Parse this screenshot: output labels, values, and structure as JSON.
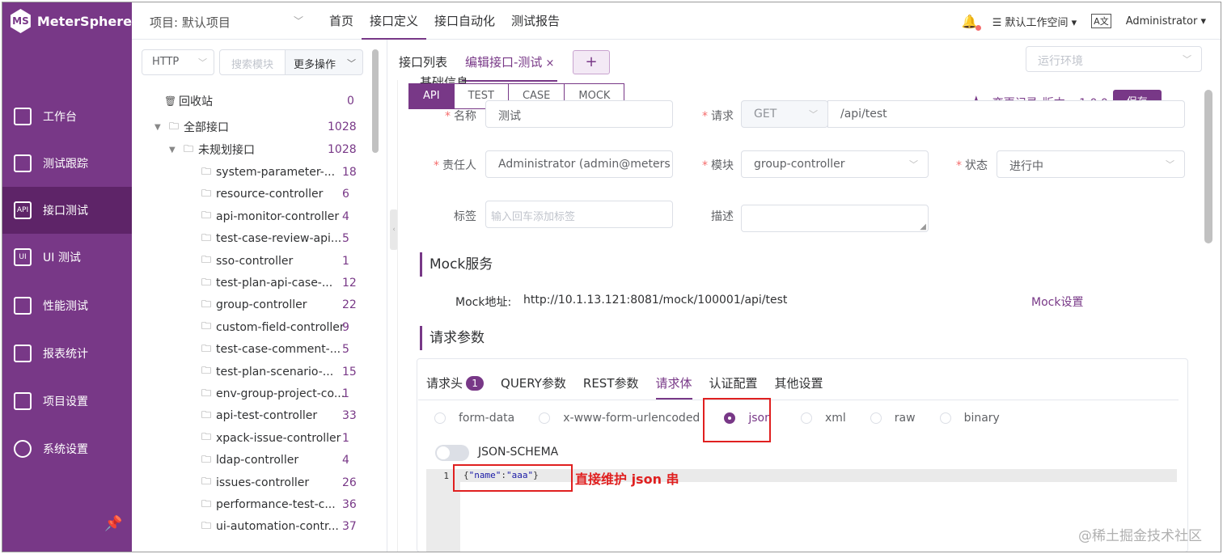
{
  "app": {
    "name": "MeterSphere",
    "logo_text": "MS"
  },
  "header": {
    "project": "项目: 默认项目",
    "menu": [
      "首页",
      "接口定义",
      "接口自动化",
      "测试报告"
    ],
    "active_menu": 1,
    "workspace": "默认工作空间",
    "user": "Administrator"
  },
  "sidebar": {
    "items": [
      {
        "label": "工作台",
        "icon": "monitor-icon"
      },
      {
        "label": "测试跟踪",
        "icon": "clipboard-icon"
      },
      {
        "label": "接口测试",
        "icon": "api-icon",
        "icon_text": "API"
      },
      {
        "label": "UI 测试",
        "icon": "ui-icon",
        "icon_text": "UI"
      },
      {
        "label": "性能测试",
        "icon": "chart-icon"
      },
      {
        "label": "报表统计",
        "icon": "report-icon"
      },
      {
        "label": "项目设置",
        "icon": "folder-icon"
      },
      {
        "label": "系统设置",
        "icon": "gears-icon"
      }
    ],
    "active": 2
  },
  "tree": {
    "protocol": "HTTP",
    "search_placeholder": "搜索模块",
    "more_label": "更多操作",
    "recycle": {
      "label": "回收站",
      "count": "0"
    },
    "all": {
      "label": "全部接口",
      "count": "1028"
    },
    "unplanned": {
      "label": "未规划接口",
      "count": "1028"
    },
    "modules": [
      {
        "label": "system-parameter-...",
        "count": "18"
      },
      {
        "label": "resource-controller",
        "count": "6"
      },
      {
        "label": "api-monitor-controller",
        "count": "4"
      },
      {
        "label": "test-case-review-api...",
        "count": "5"
      },
      {
        "label": "sso-controller",
        "count": "1"
      },
      {
        "label": "test-plan-api-case-...",
        "count": "12"
      },
      {
        "label": "group-controller",
        "count": "22"
      },
      {
        "label": "custom-field-controller",
        "count": "9"
      },
      {
        "label": "test-case-comment-...",
        "count": "5"
      },
      {
        "label": "test-plan-scenario-...",
        "count": "15"
      },
      {
        "label": "env-group-project-co...",
        "count": "1"
      },
      {
        "label": "api-test-controller",
        "count": "33"
      },
      {
        "label": "xpack-issue-controller",
        "count": "1"
      },
      {
        "label": "ldap-controller",
        "count": "4"
      },
      {
        "label": "issues-controller",
        "count": "26"
      },
      {
        "label": "performance-test-c...",
        "count": "36"
      },
      {
        "label": "ui-automation-contr...",
        "count": "37"
      }
    ]
  },
  "tabs": {
    "items": [
      {
        "label": "接口列表"
      },
      {
        "label": "编辑接口-测试",
        "close": "×"
      }
    ],
    "add": "+",
    "env_placeholder": "运行环境"
  },
  "editor": {
    "modes": [
      "API",
      "TEST",
      "CASE",
      "MOCK"
    ],
    "active_mode": 0,
    "basic_title": "基础信息",
    "change_log": "变更记录",
    "version": "版本: v1.0.0",
    "save": "保存",
    "fields": {
      "name_label": "名称",
      "name_value": "测试",
      "request_label": "请求",
      "method": "GET",
      "path": "/api/test",
      "owner_label": "责任人",
      "owner_value": "Administrator (admin@meters",
      "module_label": "模块",
      "module_value": "group-controller",
      "status_label": "状态",
      "status_value": "进行中",
      "tag_label": "标签",
      "tag_placeholder": "输入回车添加标签",
      "desc_label": "描述"
    },
    "mock": {
      "title": "Mock服务",
      "addr_label": "Mock地址:",
      "addr": "http://10.1.13.121:8081/mock/100001/api/test",
      "settings": "Mock设置"
    },
    "params": {
      "title": "请求参数",
      "tabs": [
        "请求头",
        "QUERY参数",
        "REST参数",
        "请求体",
        "认证配置",
        "其他设置"
      ],
      "header_badge": "1",
      "active_tab": 3,
      "body_types": [
        "form-data",
        "x-www-form-urlencoded",
        "json",
        "xml",
        "raw",
        "binary"
      ],
      "body_selected": "json",
      "json_schema": "JSON-SCHEMA",
      "line_no": "1",
      "code_open": "{",
      "code_key": "\"name\"",
      "code_colon": ":",
      "code_val": "\"aaa\"",
      "code_close": "}"
    }
  },
  "annotation": "直接维护 json 串",
  "watermark": "@稀土掘金技术社区",
  "colors": {
    "brand": "#783887",
    "highlight": "#e02020"
  }
}
